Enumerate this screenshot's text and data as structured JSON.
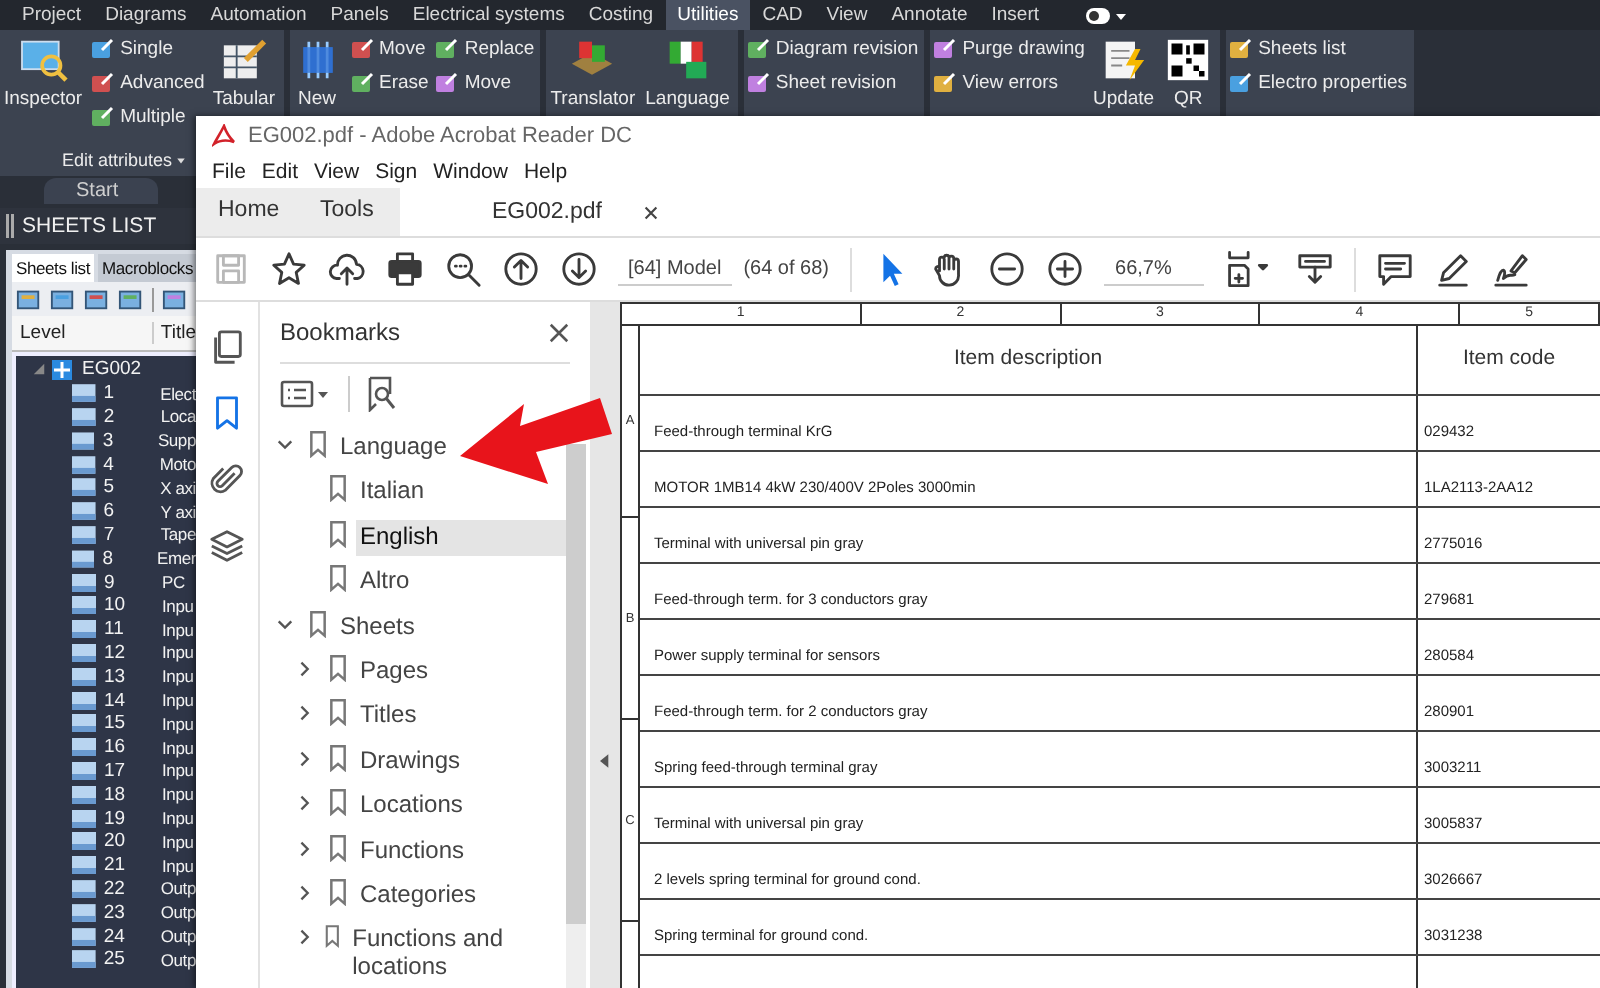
{
  "app": {
    "ribbon_tabs": [
      {
        "label": "Project",
        "selected": false
      },
      {
        "label": "Diagrams",
        "selected": false
      },
      {
        "label": "Automation",
        "selected": false
      },
      {
        "label": "Panels",
        "selected": false
      },
      {
        "label": "Electrical systems",
        "selected": false
      },
      {
        "label": "Costing",
        "selected": false
      },
      {
        "label": "Utilities",
        "selected": true
      },
      {
        "label": "CAD",
        "selected": false
      },
      {
        "label": "View",
        "selected": false
      },
      {
        "label": "Annotate",
        "selected": false
      },
      {
        "label": "Insert",
        "selected": false
      }
    ],
    "ribbon_groups": [
      {
        "label": "Edit attributes",
        "items": [
          {
            "kind": "large",
            "label": "Inspector"
          },
          {
            "kind": "stack",
            "entries": [
              "Single",
              "Advanced",
              "Multiple"
            ]
          },
          {
            "kind": "large",
            "label": "Tabular"
          }
        ]
      },
      {
        "items": [
          {
            "kind": "large",
            "label": "New"
          },
          {
            "kind": "stack",
            "entries": [
              "Move",
              "Erase"
            ]
          },
          {
            "kind": "stack",
            "entries": [
              "Replace",
              "Move"
            ]
          }
        ]
      },
      {
        "items": [
          {
            "kind": "large",
            "label": "Translator"
          },
          {
            "kind": "large",
            "label": "Language"
          }
        ]
      },
      {
        "items": [
          {
            "kind": "stack",
            "entries": [
              "Diagram revision",
              "Sheet revision"
            ]
          }
        ]
      },
      {
        "items": [
          {
            "kind": "stack",
            "entries": [
              "Purge drawing",
              "View errors"
            ]
          },
          {
            "kind": "large",
            "label": "Update"
          },
          {
            "kind": "large",
            "label": "QR"
          }
        ]
      },
      {
        "items": [
          {
            "kind": "stack",
            "entries": [
              "Sheets list",
              "Electro properties"
            ]
          }
        ]
      }
    ],
    "document_tab": "Start",
    "sheets_panel": {
      "title": "SHEETS LIST",
      "tabs": [
        {
          "label": "Sheets list",
          "selected": true
        },
        {
          "label": "Macroblocks",
          "selected": false
        }
      ],
      "columns": [
        "Level",
        "Title"
      ],
      "tree": {
        "label": "EG002",
        "expanded": true,
        "children": [
          {
            "number": "1",
            "title": "Elect"
          },
          {
            "number": "2",
            "title": "Loca"
          },
          {
            "number": "3",
            "title": "Supp"
          },
          {
            "number": "4",
            "title": "Moto"
          },
          {
            "number": "5",
            "title": "X axi"
          },
          {
            "number": "6",
            "title": "Y axi"
          },
          {
            "number": "7",
            "title": "Tape"
          },
          {
            "number": "8",
            "title": "Emer"
          },
          {
            "number": "9",
            "title": "PC"
          },
          {
            "number": "10",
            "title": "Inpu"
          },
          {
            "number": "11",
            "title": "Inpu"
          },
          {
            "number": "12",
            "title": "Inpu"
          },
          {
            "number": "13",
            "title": "Inpu"
          },
          {
            "number": "14",
            "title": "Inpu"
          },
          {
            "number": "15",
            "title": "Inpu"
          },
          {
            "number": "16",
            "title": "Inpu"
          },
          {
            "number": "17",
            "title": "Inpu"
          },
          {
            "number": "18",
            "title": "Inpu"
          },
          {
            "number": "19",
            "title": "Inpu"
          },
          {
            "number": "20",
            "title": "Inpu"
          },
          {
            "number": "21",
            "title": "Inpu"
          },
          {
            "number": "22",
            "title": "Outp"
          },
          {
            "number": "23",
            "title": "Outp"
          },
          {
            "number": "24",
            "title": "Outp"
          },
          {
            "number": "25",
            "title": "Outp"
          }
        ]
      }
    }
  },
  "acrobat": {
    "title": "EG002.pdf - Adobe Acrobat Reader DC",
    "menu": [
      "File",
      "Edit",
      "View",
      "Sign",
      "Window",
      "Help"
    ],
    "tabs": [
      {
        "kind": "nav",
        "label": "Home",
        "selected": false
      },
      {
        "kind": "nav",
        "label": "Tools",
        "selected": false
      },
      {
        "kind": "document",
        "label": "EG002.pdf",
        "selected": true
      }
    ],
    "toolbar": [
      {
        "kind": "save",
        "disabled": true
      },
      {
        "kind": "star",
        "disabled": false
      },
      {
        "kind": "upload",
        "disabled": false
      },
      {
        "kind": "print",
        "disabled": false
      },
      {
        "kind": "search",
        "disabled": false
      },
      {
        "kind": "page_up",
        "disabled": false
      },
      {
        "kind": "page_down",
        "disabled": false
      },
      {
        "kind": "page_field",
        "value": "[64] Model"
      },
      {
        "kind": "page_count",
        "text": "(64 of 68)"
      },
      {
        "kind": "separator"
      },
      {
        "kind": "pointer",
        "disabled": false,
        "selected": true
      },
      {
        "kind": "hand",
        "disabled": false,
        "selected": false
      },
      {
        "kind": "zoom_out",
        "disabled": false
      },
      {
        "kind": "zoom_in",
        "disabled": false
      },
      {
        "kind": "zoom_select",
        "value": "66,7%"
      },
      {
        "kind": "fit_page",
        "disabled": false
      },
      {
        "kind": "scroll_mode",
        "disabled": false
      },
      {
        "kind": "separator"
      },
      {
        "kind": "comment",
        "disabled": false
      },
      {
        "kind": "highlight",
        "disabled": false
      },
      {
        "kind": "sign",
        "disabled": false
      }
    ],
    "side_rail": [
      {
        "kind": "pages",
        "selected": false
      },
      {
        "kind": "bookmarks",
        "selected": true
      },
      {
        "kind": "attachments",
        "selected": false
      },
      {
        "kind": "layers",
        "selected": false
      }
    ],
    "bookmarks": {
      "title": "Bookmarks",
      "items": [
        {
          "label": "Language",
          "expanded": true,
          "selected": false,
          "children": [
            {
              "label": "Italian",
              "selected": false
            },
            {
              "label": "English",
              "selected": true
            },
            {
              "label": "Altro",
              "selected": false
            }
          ]
        },
        {
          "label": "Sheets",
          "expanded": true,
          "selected": false,
          "children": [
            {
              "label": "Pages",
              "expanded": false,
              "selected": false
            },
            {
              "label": "Titles",
              "expanded": false,
              "selected": false
            },
            {
              "label": "Drawings",
              "expanded": false,
              "selected": false
            },
            {
              "label": "Locations",
              "expanded": false,
              "selected": false
            },
            {
              "label": "Functions",
              "expanded": false,
              "selected": false
            },
            {
              "label": "Categories",
              "expanded": false,
              "selected": false
            },
            {
              "label": "Functions and locations",
              "expanded": false,
              "selected": false
            }
          ]
        }
      ]
    },
    "sheet": {
      "column_numbers": [
        "1",
        "2",
        "3",
        "4",
        "5"
      ],
      "row_letters": [
        "A",
        "B",
        "C"
      ],
      "table": {
        "columns": [
          "Item description",
          "Item code"
        ],
        "rows": [
          {
            "description": "Feed-through terminal KrG",
            "code": "029432"
          },
          {
            "description": "MOTOR 1MB14 4kW 230/400V 2Poles 3000min",
            "code": "1LA2113-2AA12"
          },
          {
            "description": "Terminal with universal pin gray",
            "code": "2775016"
          },
          {
            "description": "Feed-through term. for 3 conductors gray",
            "code": "279681"
          },
          {
            "description": "Power supply terminal for sensors",
            "code": "280584"
          },
          {
            "description": "Feed-through term. for 2 conductors gray",
            "code": "280901"
          },
          {
            "description": "Spring feed-through terminal gray",
            "code": "3003211"
          },
          {
            "description": "Terminal with universal pin gray",
            "code": "3005837"
          },
          {
            "description": "2 levels spring terminal for ground cond.",
            "code": "3026667"
          },
          {
            "description": "Spring terminal for ground cond.",
            "code": "3031238"
          }
        ]
      }
    }
  }
}
